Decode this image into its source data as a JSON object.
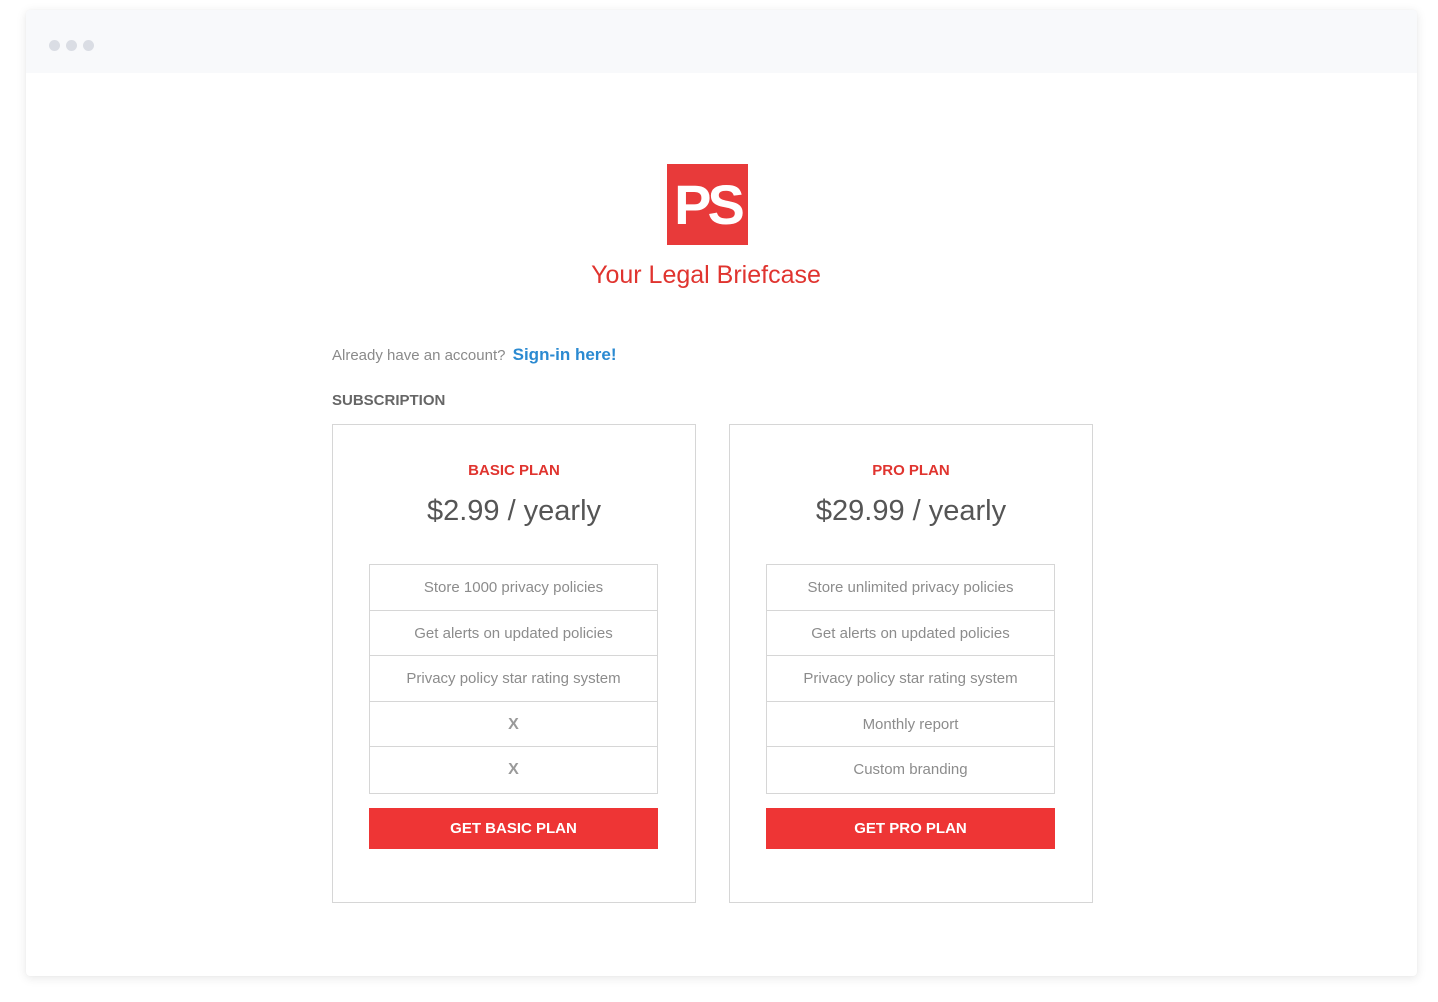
{
  "brand": {
    "logo_text": "PS",
    "tagline": "Your Legal Briefcase",
    "colors": {
      "accent": "#e83a3a",
      "link": "#2b8ad1"
    }
  },
  "account": {
    "prompt": "Already have an account?",
    "signin_link": "Sign-in here!"
  },
  "subscription": {
    "label": "SUBSCRIPTION",
    "plans": [
      {
        "name": "BASIC PLAN",
        "price": "$2.99 / yearly",
        "features": [
          "Store 1000 privacy policies",
          "Get alerts on updated policies",
          "Privacy policy star rating system",
          "X",
          "X"
        ],
        "cta": "GET BASIC PLAN"
      },
      {
        "name": "PRO PLAN",
        "price": "$29.99 / yearly",
        "features": [
          "Store unlimited privacy policies",
          "Get alerts on updated policies",
          "Privacy policy star rating system",
          "Monthly report",
          "Custom branding"
        ],
        "cta": "GET PRO PLAN"
      }
    ]
  }
}
